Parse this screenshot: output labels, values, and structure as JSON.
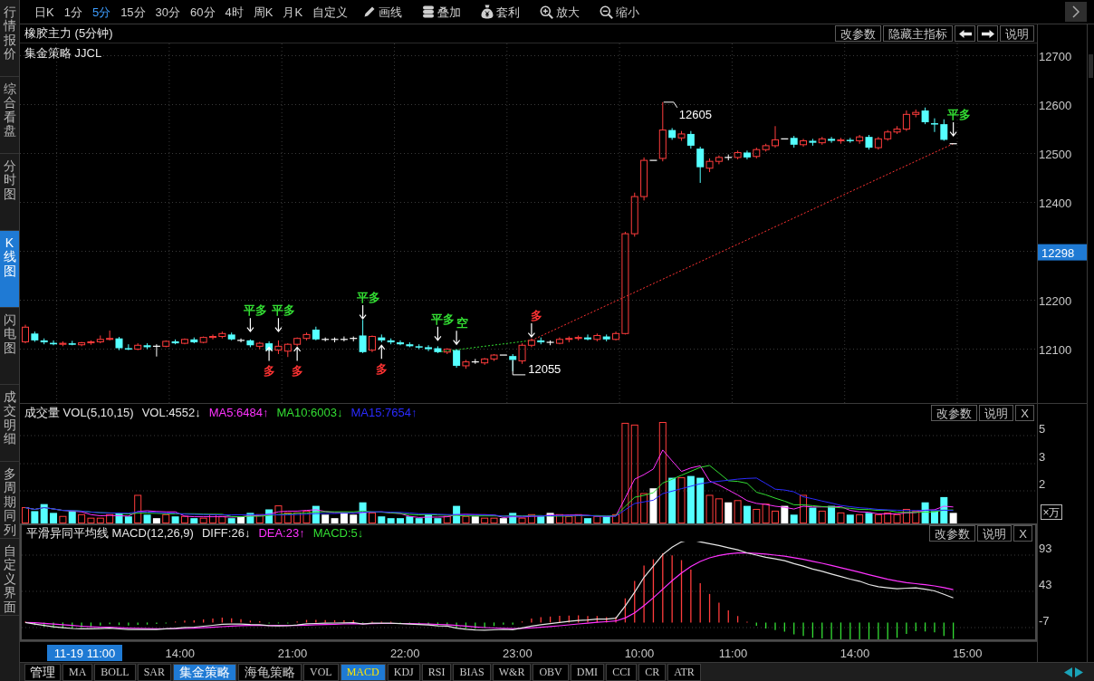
{
  "sidebar": {
    "tabs": [
      {
        "label": "行情报价",
        "selected": false
      },
      {
        "label": "综合看盘",
        "selected": false
      },
      {
        "label": "分时图",
        "selected": false
      },
      {
        "label": "K线图",
        "selected": true
      },
      {
        "label": "闪电图",
        "selected": false
      },
      {
        "label": "成交明细",
        "selected": false
      },
      {
        "label": "多周期同列",
        "selected": false
      },
      {
        "label": "自定义界面",
        "selected": false
      }
    ]
  },
  "toolbar": {
    "periods": [
      {
        "label": "日K",
        "selected": false
      },
      {
        "label": "1分",
        "selected": false
      },
      {
        "label": "5分",
        "selected": true
      },
      {
        "label": "15分",
        "selected": false
      },
      {
        "label": "30分",
        "selected": false
      },
      {
        "label": "60分",
        "selected": false
      },
      {
        "label": "4时",
        "selected": false
      },
      {
        "label": "周K",
        "selected": false
      },
      {
        "label": "月K",
        "selected": false
      },
      {
        "label": "自定义",
        "selected": false
      }
    ],
    "tools": [
      {
        "label": "画线",
        "kind": "pencil"
      },
      {
        "label": "叠加",
        "kind": "stack"
      },
      {
        "label": "套利",
        "kind": "bag"
      },
      {
        "label": "放大",
        "kind": "zoom_in"
      },
      {
        "label": "缩小",
        "kind": "zoom_out"
      }
    ]
  },
  "main_chart": {
    "title": "橡胶主力 (5分钟)",
    "indicator": "集金策略 JJCL",
    "buttons": [
      {
        "kind": "text",
        "label": "改参数"
      },
      {
        "kind": "text",
        "label": "隐藏主指标"
      },
      {
        "kind": "arrow_left"
      },
      {
        "kind": "arrow_right"
      },
      {
        "kind": "text",
        "label": "说明"
      }
    ],
    "price_axis": [
      "12700",
      "12600",
      "12500",
      "12400",
      "12200",
      "12100"
    ],
    "cursor_price": "12298",
    "signals": [
      {
        "text": "平多",
        "color": "#33dd33"
      },
      {
        "text": "平多",
        "color": "#33dd33"
      },
      {
        "text": "多",
        "color": "#ff3333"
      },
      {
        "text": "多",
        "color": "#ff3333"
      },
      {
        "text": "平多",
        "color": "#33dd33"
      },
      {
        "text": "多",
        "color": "#ff3333"
      },
      {
        "text": "平多",
        "color": "#33dd33"
      },
      {
        "text": "空",
        "color": "#33dd33"
      },
      {
        "text": "多",
        "color": "#ff3333"
      },
      {
        "text": "平多",
        "color": "#33dd33"
      }
    ],
    "callouts": [
      "12605",
      "12055"
    ]
  },
  "volume_chart": {
    "title": "成交量 VOL(5,10,15)",
    "legend": [
      {
        "text": "VOL:4552↓",
        "color": "#e6e6e6"
      },
      {
        "text": "MA5:6484↑",
        "color": "#ff33ff"
      },
      {
        "text": "MA10:6003↓",
        "color": "#33dd33"
      },
      {
        "text": "MA15:7654↑",
        "color": "#2b2bff"
      }
    ],
    "buttons": [
      "改参数",
      "说明",
      "X"
    ],
    "axis": [
      "5",
      "3",
      "2"
    ],
    "unit": "×万"
  },
  "macd_chart": {
    "title": "平滑异同平均线 MACD(12,26,9)",
    "legend": [
      {
        "text": "DIFF:26↓",
        "color": "#e6e6e6"
      },
      {
        "text": "DEA:23↑",
        "color": "#ff33ff"
      },
      {
        "text": "MACD:5↓",
        "color": "#33dd33"
      }
    ],
    "buttons": [
      "改参数",
      "说明",
      "X"
    ],
    "axis": [
      "93",
      "43",
      "-7"
    ]
  },
  "time_axis": {
    "cursor": "11-19 11:00",
    "labels": [
      "14:00",
      "21:00",
      "22:00",
      "23:00",
      "10:00",
      "11:00",
      "14:00",
      "15:00"
    ]
  },
  "bottom_bar": {
    "manage": "管理",
    "tabs": [
      {
        "label": "MA",
        "kind": "indicator",
        "selected": false
      },
      {
        "label": "BOLL",
        "kind": "indicator",
        "selected": false
      },
      {
        "label": "SAR",
        "kind": "indicator",
        "selected": false
      },
      {
        "label": "集金策略",
        "kind": "strategy",
        "selected": true
      },
      {
        "label": "海龟策略",
        "kind": "strategy",
        "selected": false
      },
      {
        "label": "VOL",
        "kind": "indicator",
        "selected": false
      },
      {
        "label": "MACD",
        "kind": "indicator",
        "selected": true
      },
      {
        "label": "KDJ",
        "kind": "indicator",
        "selected": false
      },
      {
        "label": "RSI",
        "kind": "indicator",
        "selected": false
      },
      {
        "label": "BIAS",
        "kind": "indicator",
        "selected": false
      },
      {
        "label": "W&R",
        "kind": "indicator",
        "selected": false
      },
      {
        "label": "OBV",
        "kind": "indicator",
        "selected": false
      },
      {
        "label": "DMI",
        "kind": "indicator",
        "selected": false
      },
      {
        "label": "CCI",
        "kind": "indicator",
        "selected": false
      },
      {
        "label": "CR",
        "kind": "indicator",
        "selected": false
      },
      {
        "label": "ATR",
        "kind": "indicator",
        "selected": false
      }
    ]
  }
}
